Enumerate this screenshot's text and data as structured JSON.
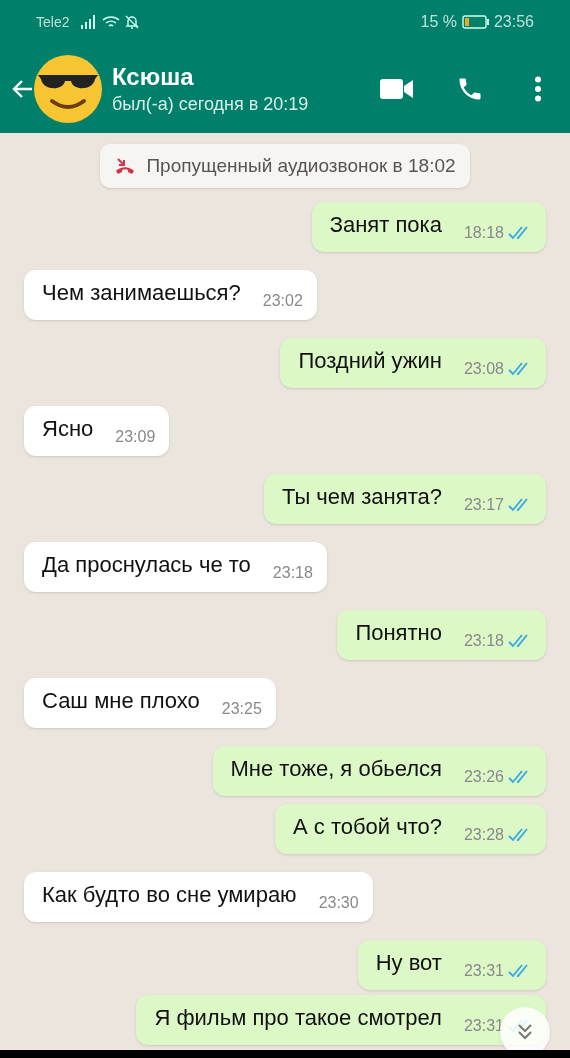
{
  "status_bar": {
    "carrier": "Tele2",
    "battery": "15 %",
    "time": "23:56"
  },
  "header": {
    "name": "Ксюша",
    "last_seen": "был(-а) сегодня в 20:19"
  },
  "system_notice": {
    "text": "Пропущенный аудиозвонок в 18:02"
  },
  "messages": [
    {
      "kind": "out",
      "text": "Занят пока",
      "time": "18:18",
      "read": true
    },
    {
      "kind": "in",
      "text": "Чем занимаешься?",
      "time": "23:02"
    },
    {
      "kind": "out",
      "text": "Поздний ужин",
      "time": "23:08",
      "read": true
    },
    {
      "kind": "in",
      "text": "Ясно",
      "time": "23:09"
    },
    {
      "kind": "out",
      "text": "Ты чем занята?",
      "time": "23:17",
      "read": true
    },
    {
      "kind": "in",
      "text": "Да проснулась че то",
      "time": "23:18"
    },
    {
      "kind": "out",
      "text": "Понятно",
      "time": "23:18",
      "read": true
    },
    {
      "kind": "in",
      "text": "Саш мне плохо",
      "time": "23:25"
    },
    {
      "kind": "out",
      "text": "Мне тоже, я обьелся",
      "time": "23:26",
      "read": true
    },
    {
      "kind": "out",
      "text": "А с тобой что?",
      "time": "23:28",
      "read": true
    },
    {
      "kind": "in",
      "text": "Как будто во сне умираю",
      "time": "23:30"
    },
    {
      "kind": "out",
      "text": "Ну вот",
      "time": "23:31",
      "read": true
    },
    {
      "kind": "out",
      "text": "Я фильм про такое смотрел",
      "time": "23:31",
      "read": true
    }
  ]
}
